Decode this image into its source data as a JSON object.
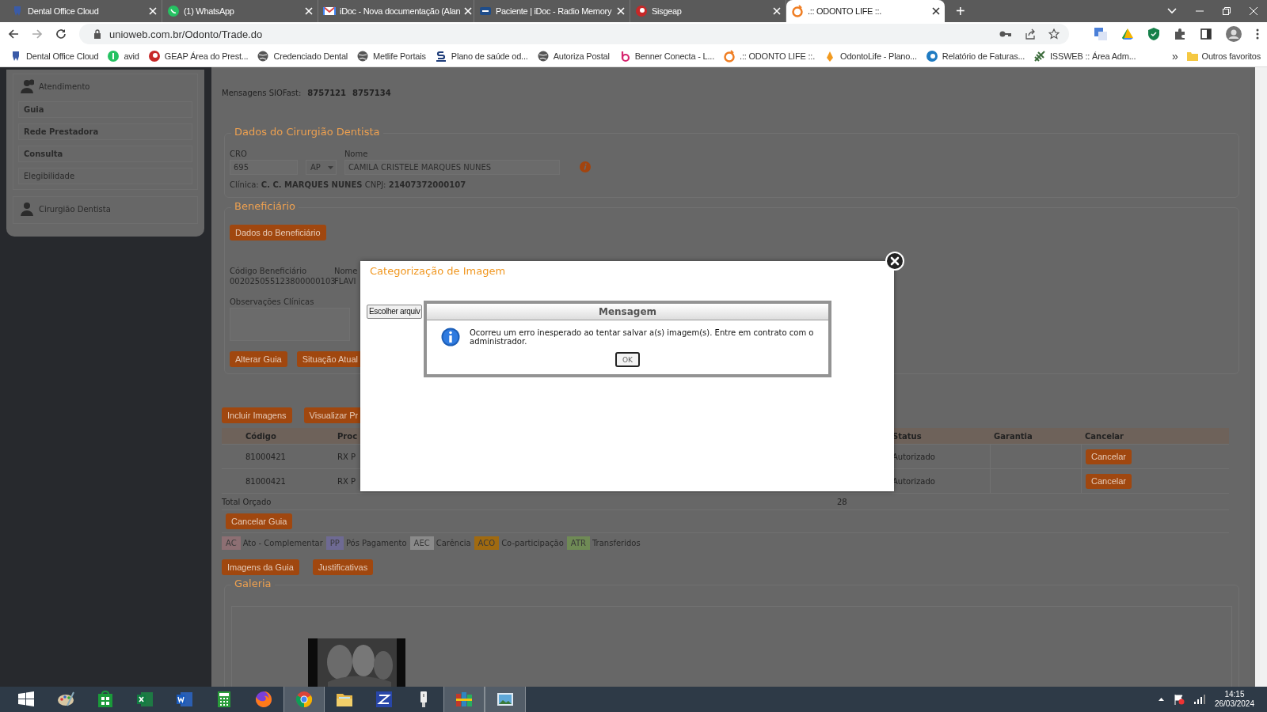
{
  "browser": {
    "tabs": [
      {
        "title": "Dental Office Cloud",
        "selected": false
      },
      {
        "title": "(1) WhatsApp",
        "selected": false
      },
      {
        "title": "iDoc - Nova documentação (Alan",
        "selected": false
      },
      {
        "title": "Paciente | iDoc - Radio Memory",
        "selected": false
      },
      {
        "title": "Sisgeap",
        "selected": false
      },
      {
        "title": ".:: ODONTO LIFE ::.",
        "selected": true
      }
    ],
    "new_tab": "+",
    "url": "unioweb.com.br/Odonto/Trade.do",
    "bookmarks": [
      "Dental Office Cloud",
      "avid",
      "GEAP Área do Prest...",
      "Credenciado Dental",
      "Metlife Portais",
      "Plano de saúde od...",
      "Autoriza Postal",
      "Benner Conecta - L...",
      ".:: ODONTO LIFE ::.",
      "OdontoLife - Plano...",
      "Relatório de Faturas...",
      "ISSWEB :: Área Adm..."
    ],
    "overflow": "»",
    "other_bookmarks": "Outros favoritos"
  },
  "sidebar": {
    "groups": [
      {
        "title": "Atendimento",
        "items": [
          {
            "label": "Guia",
            "bold": true
          },
          {
            "label": "Rede Prestadora",
            "bold": true
          },
          {
            "label": "Consulta",
            "bold": true
          },
          {
            "label": "Elegibilidade",
            "bold": false
          }
        ]
      },
      {
        "title": "Cirurgião Dentista"
      }
    ]
  },
  "page": {
    "messages": {
      "label": "Mensagens SIOFast:",
      "values": [
        "8757121",
        "8757134"
      ]
    },
    "dentist": {
      "legend": "Dados do Cirurgião Dentista",
      "cro_label": "CRO",
      "cro": "695",
      "uf": "AP",
      "name_label": "Nome",
      "name": "CAMILA CRISTELE MARQUES NUNES",
      "clinic": "Clínica: **C. C. MARQUES NUNES** CNPJ: **21407372000107**"
    },
    "beneficiary": {
      "legend": "Beneficiário",
      "details_button": "Dados do Beneficiário",
      "code_label": "Código Beneficiário",
      "code": "002025055123800000103",
      "name_label": "Nome",
      "name": "FLAVI",
      "notes_label": "Observações Clínicas",
      "buttons": [
        "Alterar Guia",
        "Situação Atual"
      ]
    },
    "procedures": {
      "buttons": [
        "Incluir Imagens",
        "Visualizar Pr"
      ],
      "columns": [
        "Código",
        "Proc",
        "Status",
        "Garantia",
        "Cancelar"
      ],
      "rows": [
        {
          "code": "81000421",
          "procedure": "RX P",
          "status": "Autorizado",
          "action": "Cancelar"
        },
        {
          "code": "81000421",
          "procedure": "RX P",
          "status": "Autorizado",
          "action": "Cancelar"
        }
      ],
      "total_label": "Total Orçado",
      "total": "28",
      "cancel_button": "Cancelar Guia",
      "legend": [
        {
          "tag": "AC",
          "label": "Ato - Complementar",
          "color": "#8d6f73"
        },
        {
          "tag": "PP",
          "label": "Pós Pagamento",
          "color": "#6e6a93"
        },
        {
          "tag": "AEC",
          "label": "Carência",
          "color": "#8a8a8a"
        },
        {
          "tag": "ACO",
          "label": "Co-participação",
          "color": "#a06a10"
        },
        {
          "tag": "ATR",
          "label": "Transferidos",
          "color": "#6f8a55"
        }
      ],
      "bottom_buttons": [
        "Imagens da Guia",
        "Justificativas"
      ],
      "gallery_legend": "Galeria",
      "gallery": [
        {
          "kind": "picture"
        }
      ]
    }
  },
  "modal": {
    "title": "Categorização de Imagem",
    "file_button": "Escolher arquiv",
    "message": {
      "title": "Mensagem",
      "text": "Ocorreu um erro inesperado ao tentar salvar a(s) imagem(s). Entre em contrato com o administrador.",
      "ok": "OK"
    }
  },
  "taskbar": {
    "time": "14:15",
    "date": "26/03/2024"
  }
}
